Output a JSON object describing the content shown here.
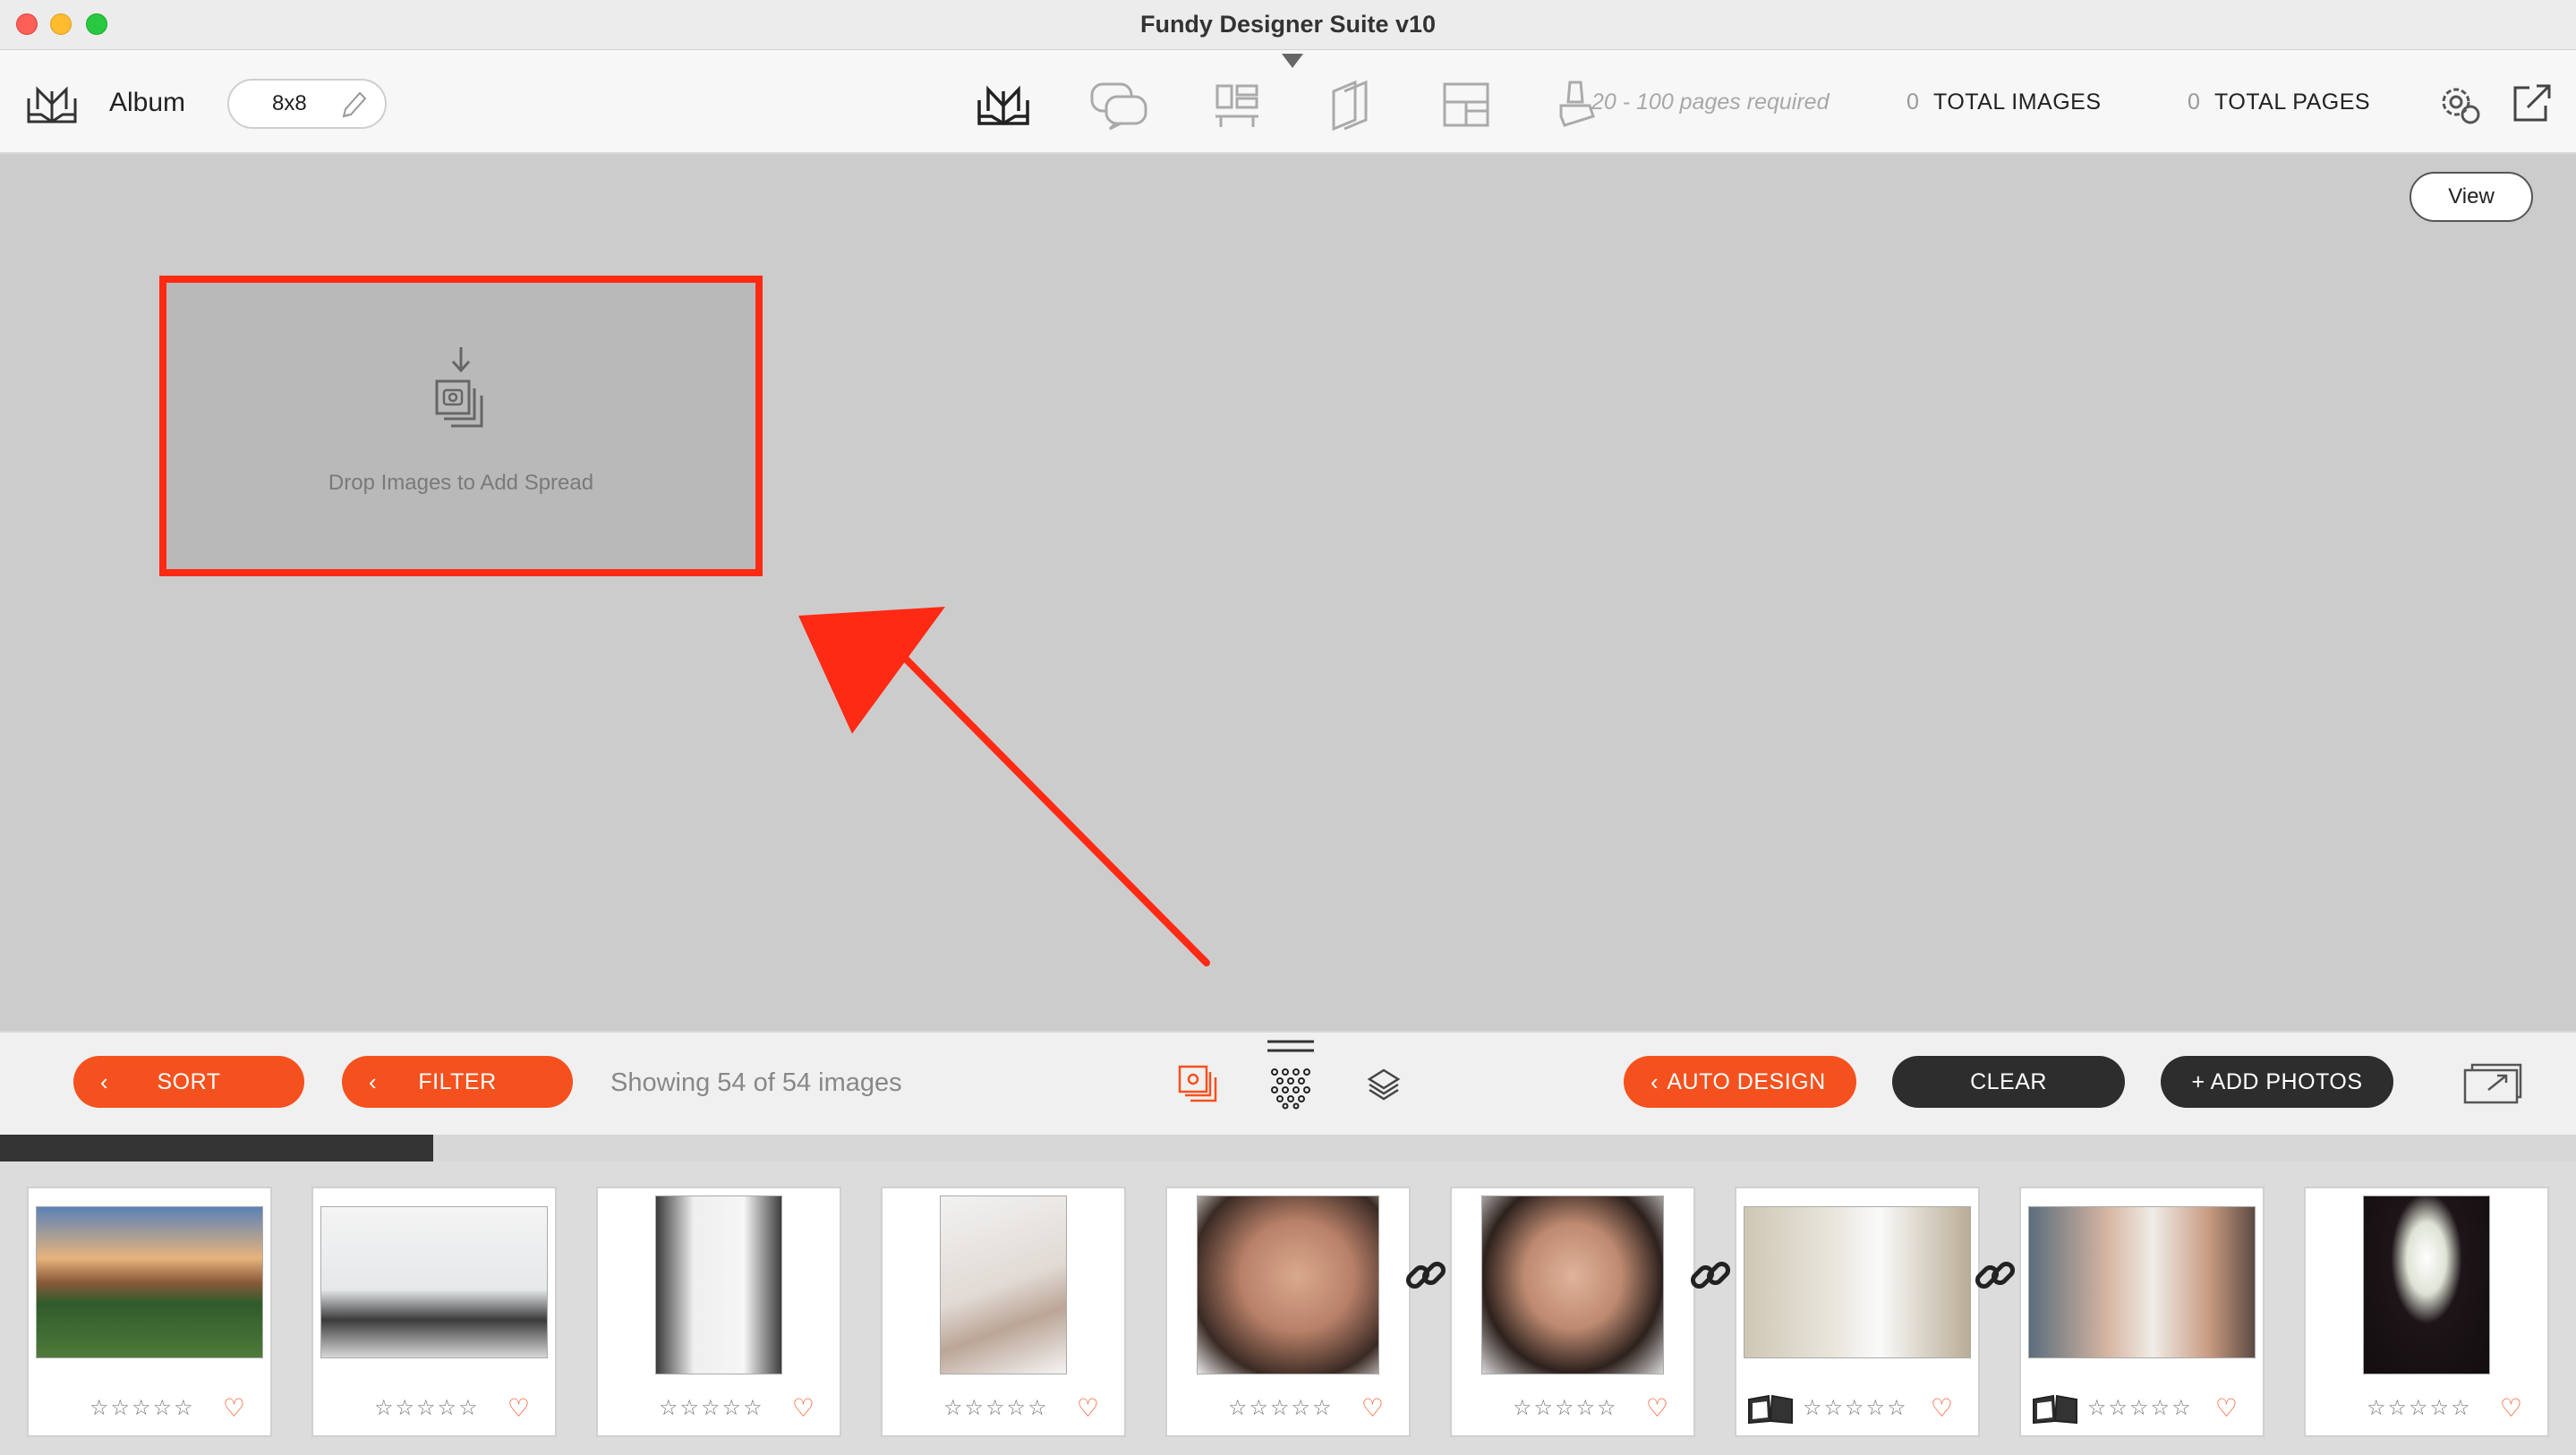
{
  "window": {
    "title": "Fundy Designer Suite v10"
  },
  "toolbar": {
    "product_label": "Album",
    "size_value": "8x8",
    "pages_required": "20 - 100 pages required",
    "total_images_count": "0",
    "total_images_label": "TOTAL IMAGES",
    "total_pages_count": "0",
    "total_pages_label": "TOTAL PAGES",
    "icons": [
      "album-icon",
      "proof-comments-icon",
      "templates-icon",
      "pages-icon",
      "layout-icon",
      "stamp-icon",
      "settings-gear-icon",
      "export-icon"
    ]
  },
  "canvas": {
    "view_label": "View",
    "drop_zone_text": "Drop Images to Add Spread",
    "highlight_color": "#ff2a14"
  },
  "bottombar": {
    "sort_label": "SORT",
    "filter_label": "FILTER",
    "showing_text": "Showing 54 of 54 images",
    "auto_design_label": "AUTO DESIGN",
    "clear_label": "CLEAR",
    "add_photos_label": "+ ADD PHOTOS",
    "accent_color": "#f5511e",
    "dark_color": "#2d2d2d"
  },
  "progress": {
    "fraction": 0.168
  },
  "thumbnails": [
    {
      "subject": "estate-garden",
      "stars": "☆☆☆☆☆",
      "heart": "♡",
      "linked_next": false,
      "book": false,
      "shape": "landscape"
    },
    {
      "subject": "couple-window-room",
      "stars": "☆☆☆☆☆",
      "heart": "♡",
      "linked_next": false,
      "book": false,
      "shape": "landscape"
    },
    {
      "subject": "wedding-dress",
      "stars": "☆☆☆☆☆",
      "heart": "♡",
      "linked_next": false,
      "book": false,
      "shape": "portrait"
    },
    {
      "subject": "writing-note",
      "stars": "☆☆☆☆☆",
      "heart": "♡",
      "linked_next": false,
      "book": false,
      "shape": "portrait"
    },
    {
      "subject": "bride-closeup-1",
      "stars": "☆☆☆☆☆",
      "heart": "♡",
      "linked_next": true,
      "book": false,
      "shape": "square"
    },
    {
      "subject": "bride-closeup-2",
      "stars": "☆☆☆☆☆",
      "heart": "♡",
      "linked_next": true,
      "book": false,
      "shape": "square"
    },
    {
      "subject": "bride-robe",
      "stars": "☆☆☆☆☆",
      "heart": "♡",
      "linked_next": true,
      "book": true,
      "shape": "landscape"
    },
    {
      "subject": "bride-mothers",
      "stars": "☆☆☆☆☆",
      "heart": "♡",
      "linked_next": false,
      "book": true,
      "shape": "landscape"
    },
    {
      "subject": "bouquet",
      "stars": "☆☆☆☆☆",
      "heart": "♡",
      "linked_next": false,
      "book": false,
      "shape": "portrait"
    }
  ]
}
